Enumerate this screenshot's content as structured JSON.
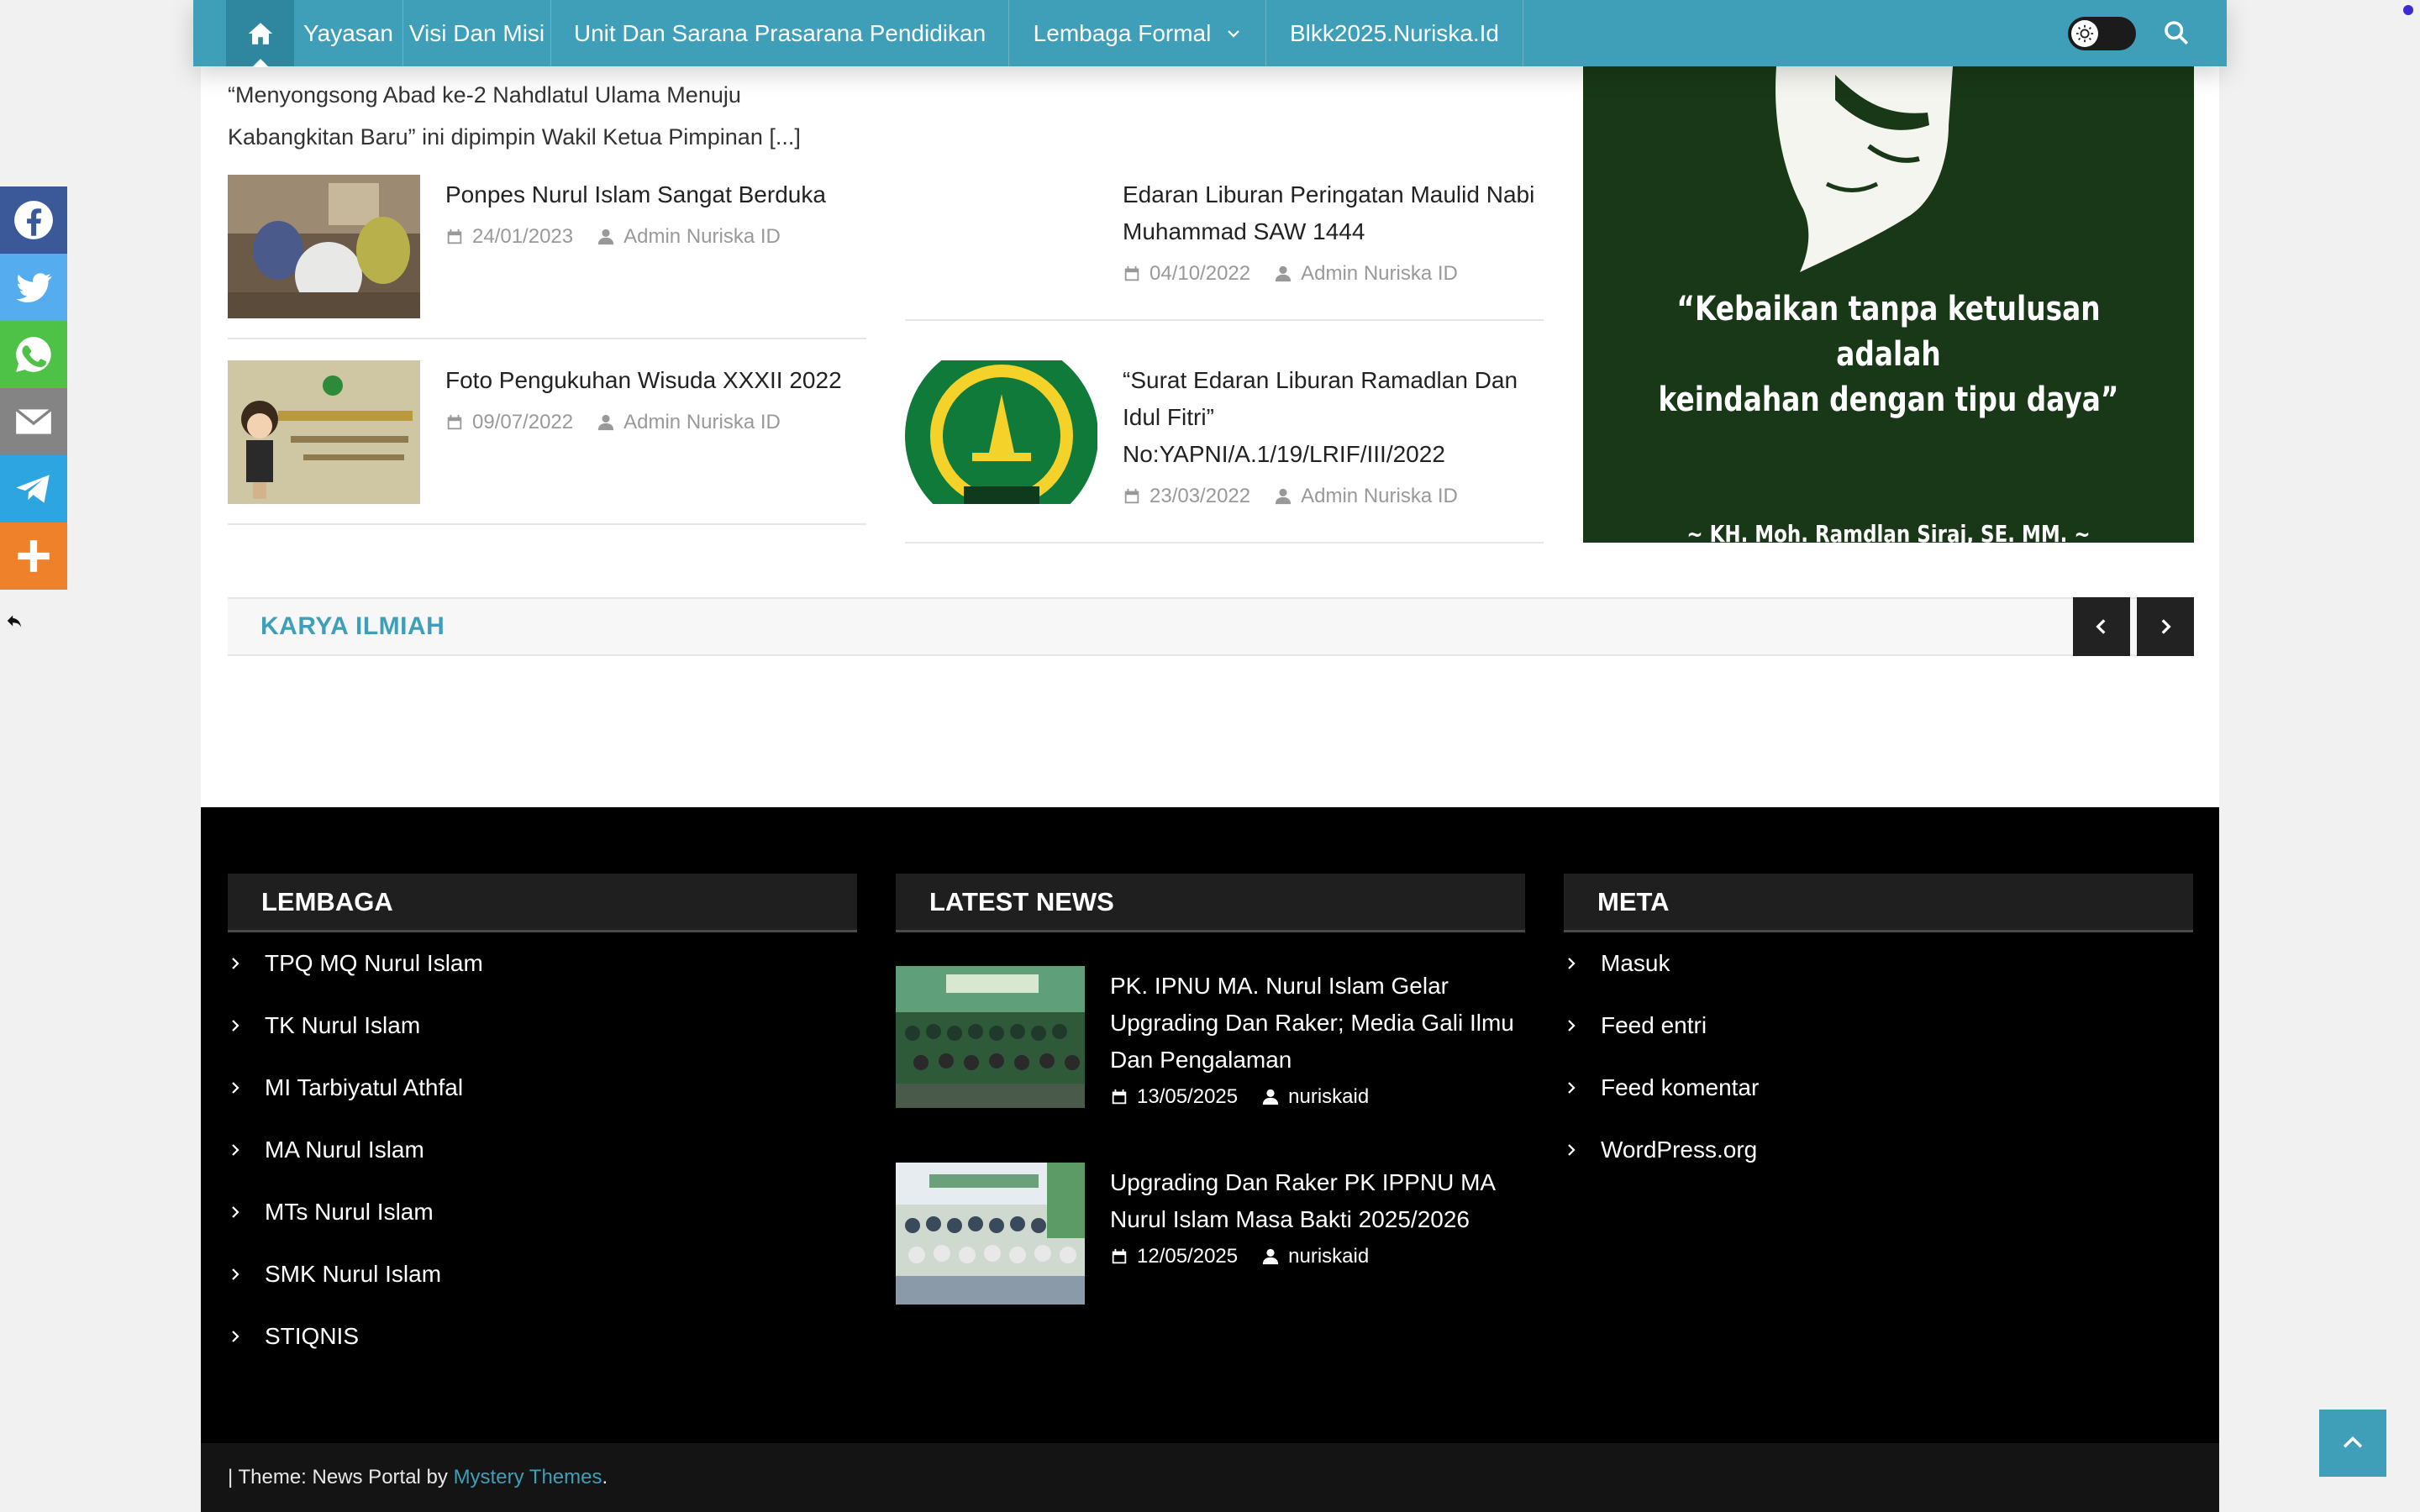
{
  "nav": {
    "home_icon": "home-icon",
    "items": [
      {
        "label": "Yayasan"
      },
      {
        "label": "Visi Dan Misi"
      },
      {
        "label": "Unit Dan Sarana Prasarana Pendidikan"
      },
      {
        "label": "Lembaga Formal"
      },
      {
        "label": "Blkk2025.Nuriska.Id"
      }
    ],
    "accent_color": "#3f9fb9"
  },
  "share": {
    "buttons": [
      {
        "name": "facebook",
        "color": "#3b5998"
      },
      {
        "name": "twitter",
        "color": "#55acee"
      },
      {
        "name": "whatsapp",
        "color": "#4dc247"
      },
      {
        "name": "email",
        "color": "#848484"
      },
      {
        "name": "telegram",
        "color": "#2ca5e0"
      },
      {
        "name": "more",
        "color": "#f0812b"
      }
    ]
  },
  "excerpt": {
    "line1": "“Menyongsong Abad ke-2 Nahdlatul Ulama Menuju",
    "line2": "Kabangkitan Baru” ini dipimpin Wakil Ketua Pimpinan [...]"
  },
  "posts": [
    {
      "title": "Ponpes Nurul Islam Sangat Berduka",
      "date": "24/01/2023",
      "author": "Admin Nuriska ID"
    },
    {
      "title_1": "Edaran Liburan Peringatan Maulid Nabi",
      "title_2": "Muhammad SAW 1444",
      "date": "04/10/2022",
      "author": "Admin Nuriska ID"
    },
    {
      "title": "Foto Pengukuhan Wisuda XXXII 2022",
      "date": "09/07/2022",
      "author": "Admin Nuriska ID"
    },
    {
      "title_1": "“Surat Edaran Liburan Ramadlan Dan",
      "title_2": "Idul Fitri”",
      "title_3": "No:YAPNI/A.1/19/LRIF/III/2022",
      "date": "23/03/2022",
      "author": "Admin Nuriska ID"
    }
  ],
  "quote": {
    "line1": "“Kebaikan tanpa ketulusan",
    "line2": "adalah",
    "line3": "keindahan dengan tipu daya”",
    "author": "~ KH. Moh. Ramdlan Siraj, SE. MM. ~"
  },
  "section": {
    "title": "KARYA ILMIAH"
  },
  "footer": {
    "lembaga": {
      "title": "LEMBAGA",
      "items": [
        "TPQ MQ Nurul Islam",
        "TK Nurul Islam",
        "MI Tarbiyatul Athfal",
        "MA Nurul Islam",
        "MTs Nurul Islam",
        "SMK Nurul Islam",
        "STIQNIS"
      ]
    },
    "latest": {
      "title": "LATEST NEWS",
      "items": [
        {
          "title_1": "PK. IPNU MA. Nurul Islam Gelar",
          "title_2": "Upgrading Dan Raker; Media Gali Ilmu",
          "title_3": "Dan Pengalaman",
          "date": "13/05/2025",
          "author": "nuriskaid"
        },
        {
          "title_1": "Upgrading Dan Raker PK IPPNU MA",
          "title_2": "Nurul Islam Masa Bakti 2025/2026",
          "date": "12/05/2025",
          "author": "nuriskaid"
        }
      ]
    },
    "meta": {
      "title": "META",
      "items": [
        "Masuk",
        "Feed entri",
        "Feed komentar",
        "WordPress.org"
      ]
    }
  },
  "copyright": {
    "prefix": "| Theme: News Portal by ",
    "link": "Mystery Themes",
    "suffix": "."
  }
}
